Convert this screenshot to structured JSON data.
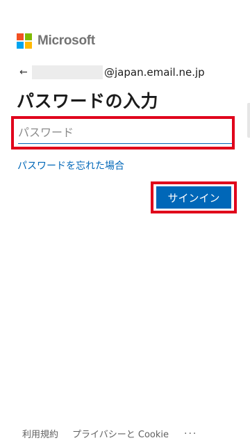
{
  "brand": {
    "name": "Microsoft",
    "colors": {
      "red": "#f25022",
      "green": "#7fba00",
      "blue": "#00a4ef",
      "yellow": "#ffb900"
    }
  },
  "identity": {
    "back_icon": "←",
    "email_suffix": "@japan.email.ne.jp"
  },
  "title": "パスワードの入力",
  "password_field": {
    "placeholder": "パスワード",
    "value": ""
  },
  "forgot_link": "パスワードを忘れた場合",
  "signin_button": "サインイン",
  "footer": {
    "terms": "利用規約",
    "privacy": "プライバシーと Cookie",
    "more": "···"
  },
  "accent_color": "#0067b8",
  "highlight_color": "#e0001b"
}
